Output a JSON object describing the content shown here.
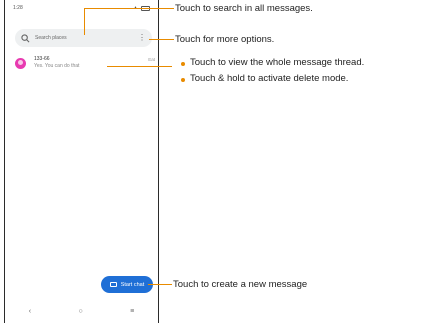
{
  "phone": {
    "status_time": "1:28",
    "search_placeholder": "Search places",
    "thread": {
      "sender": "133-66",
      "preview": "Yes. You can do that",
      "time": "Eat"
    },
    "fab_label": "Start chat"
  },
  "callouts": {
    "search": "Touch to search in all messages.",
    "more": "Touch for more options.",
    "thread_view": "Touch to view the whole message thread.",
    "thread_hold": "Touch & hold to activate delete mode.",
    "new_message": "Touch to create a new message"
  },
  "colors": {
    "accent_line": "#e88b00",
    "fab": "#1f6fd6",
    "avatar": "#e83ab0"
  }
}
